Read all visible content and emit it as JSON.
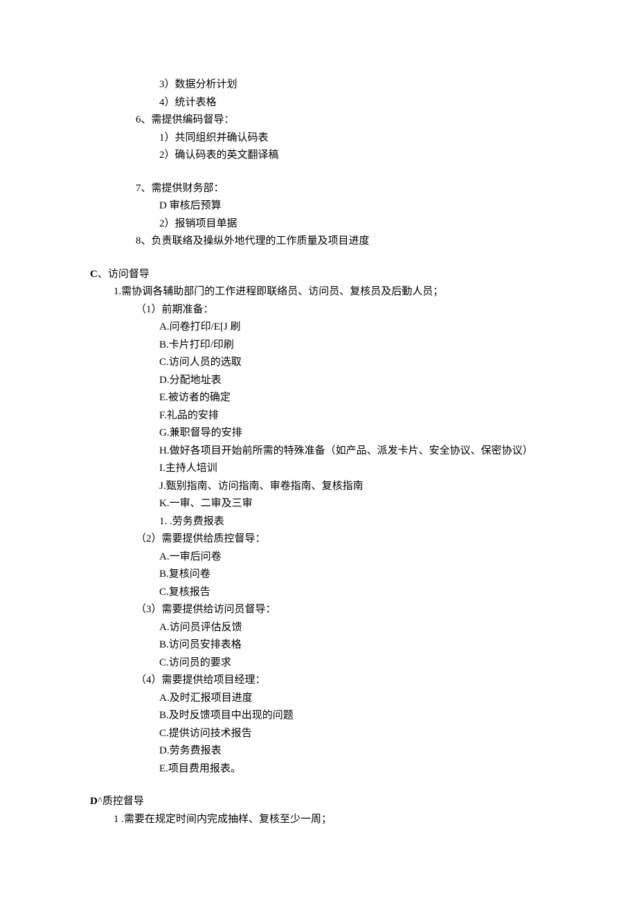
{
  "block1": {
    "items": [
      "3）数据分析计划",
      "4）统计表格",
      "6、需提供编码督导：",
      "1）共同组织并确认码表",
      "2）确认码表的英文翻译稿"
    ],
    "indents": [
      "l3",
      "l3",
      "l2",
      "l3",
      "l3"
    ]
  },
  "block2": {
    "items": [
      "7、需提供财务部：",
      "D 审核后预算",
      "2）报销项目单据",
      "8、负责联络及操纵外地代理的工作质量及项目进度"
    ],
    "indents": [
      "l2",
      "l3",
      "l3",
      "l2"
    ]
  },
  "sectionC": {
    "heading_prefix": "C",
    "heading_rest": "、访问督导",
    "line1": "1.需协调各辅助部门的工作进程即联络员、访问员、复核员及后勤人员；",
    "group1_title": "（1）前期准备：",
    "group1": [
      "A.问卷打印/E[J 刷",
      "B.卡片打印/印刷",
      "C.访问人员的选取",
      "D.分配地址表",
      "E.被访者的确定",
      "F.礼品的安排",
      "G.兼职督导的安排",
      "H.做好各项目开始前所需的特殊准备（如产品、派发卡片、安全协议、保密协议）",
      "I.主持人培训",
      "J.甄别指南、访问指南、审卷指南、复核指南",
      "K.一审、二审及三审",
      "1. .劳务费报表"
    ],
    "group2_title": "（2）需要提供给质控督导：",
    "group2": [
      "A.一审后问卷",
      "B.复核问卷",
      "C.复核报告"
    ],
    "group3_title": "（3）需要提供给访问员督导：",
    "group3": [
      "A.访问员评估反馈",
      "B.访问员安排表格",
      "C.访问员的要求"
    ],
    "group4_title": "（4）需要提供给项目经理：",
    "group4": [
      "A.及时汇报项目进度",
      "B.及时反馈项目中出现的问题",
      "C.提供访问技术报告",
      "D.劳务费报表",
      "E.项目费用报表。"
    ]
  },
  "sectionD": {
    "heading_prefix": "D",
    "heading_rest": "^质控督导",
    "line1": "1  .需要在规定时间内完成抽样、复核至少一周；"
  }
}
